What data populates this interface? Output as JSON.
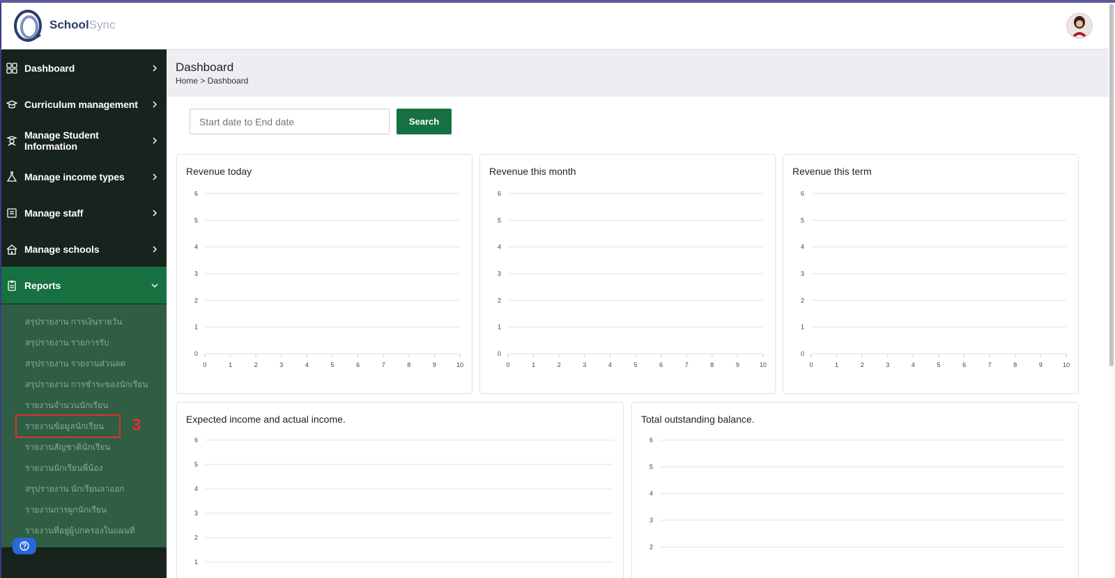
{
  "app": {
    "brand_part1": "School",
    "brand_part2": "Sync"
  },
  "sidebar": {
    "items": [
      {
        "label": "Dashboard",
        "icon": "grid-icon"
      },
      {
        "label": "Curriculum management",
        "icon": "graduation-cap-icon"
      },
      {
        "label": "Manage Student Information",
        "icon": "student-icon"
      },
      {
        "label": "Manage income types",
        "icon": "flask-icon"
      },
      {
        "label": "Manage staff",
        "icon": "staff-id-icon"
      },
      {
        "label": "Manage schools",
        "icon": "school-icon"
      },
      {
        "label": "Reports",
        "icon": "clipboard-icon"
      }
    ],
    "reports_submenu": [
      "สรุปรายงาน การเงินรายวัน",
      "สรุปรายงาน รายการรับ",
      "สรุปรายงาน รายงานส่วนลด",
      "สรุปรายงาน การชำระของนักเรียน",
      "รายงานจำนวนนักเรียน",
      "รายงานข้อมูลนักเรียน",
      "รายงานสัญชาตินักเรียน",
      "รายงานนักเรียนพี่น้อง",
      "สรุปรายงาน นักเรียนลาออก",
      "รายงานการผูกนักเรียน",
      "รายงานที่อยู่ผู้ปกครองในแผนที่"
    ],
    "annotation_label": "3"
  },
  "header": {
    "title": "Dashboard",
    "breadcrumb": "Home > Dashboard"
  },
  "filters": {
    "date_placeholder": "Start date to End date",
    "search_label": "Search"
  },
  "colors": {
    "accent_green": "#167040",
    "sidebar_bg": "#17231d",
    "submenu_bg": "#2f5e44",
    "annotation_red": "#e0302a"
  },
  "chart_data": [
    {
      "type": "line",
      "title": "Revenue today",
      "x_ticks": [
        0,
        1,
        2,
        3,
        4,
        5,
        6,
        7,
        8,
        9,
        10
      ],
      "y_ticks": [
        0,
        1,
        2,
        3,
        4,
        5,
        6
      ],
      "xlim": [
        0,
        10
      ],
      "ylim": [
        0,
        6
      ],
      "grid": true,
      "series": []
    },
    {
      "type": "line",
      "title": "Revenue this month",
      "x_ticks": [
        0,
        1,
        2,
        3,
        4,
        5,
        6,
        7,
        8,
        9,
        10
      ],
      "y_ticks": [
        0,
        1,
        2,
        3,
        4,
        5,
        6
      ],
      "xlim": [
        0,
        10
      ],
      "ylim": [
        0,
        6
      ],
      "grid": true,
      "series": []
    },
    {
      "type": "line",
      "title": "Revenue this term",
      "x_ticks": [
        0,
        1,
        2,
        3,
        4,
        5,
        6,
        7,
        8,
        9,
        10
      ],
      "y_ticks": [
        0,
        1,
        2,
        3,
        4,
        5,
        6
      ],
      "xlim": [
        0,
        10
      ],
      "ylim": [
        0,
        6
      ],
      "grid": true,
      "series": []
    },
    {
      "type": "line",
      "title": "Expected income and actual income.",
      "y_ticks": [
        1,
        2,
        3,
        4,
        5,
        6
      ],
      "ylim": [
        0,
        6
      ],
      "grid": true,
      "series": []
    },
    {
      "type": "line",
      "title": "Total outstanding balance.",
      "y_ticks": [
        2,
        3,
        4,
        5,
        6
      ],
      "ylim": [
        0,
        6
      ],
      "grid": true,
      "series": []
    }
  ]
}
